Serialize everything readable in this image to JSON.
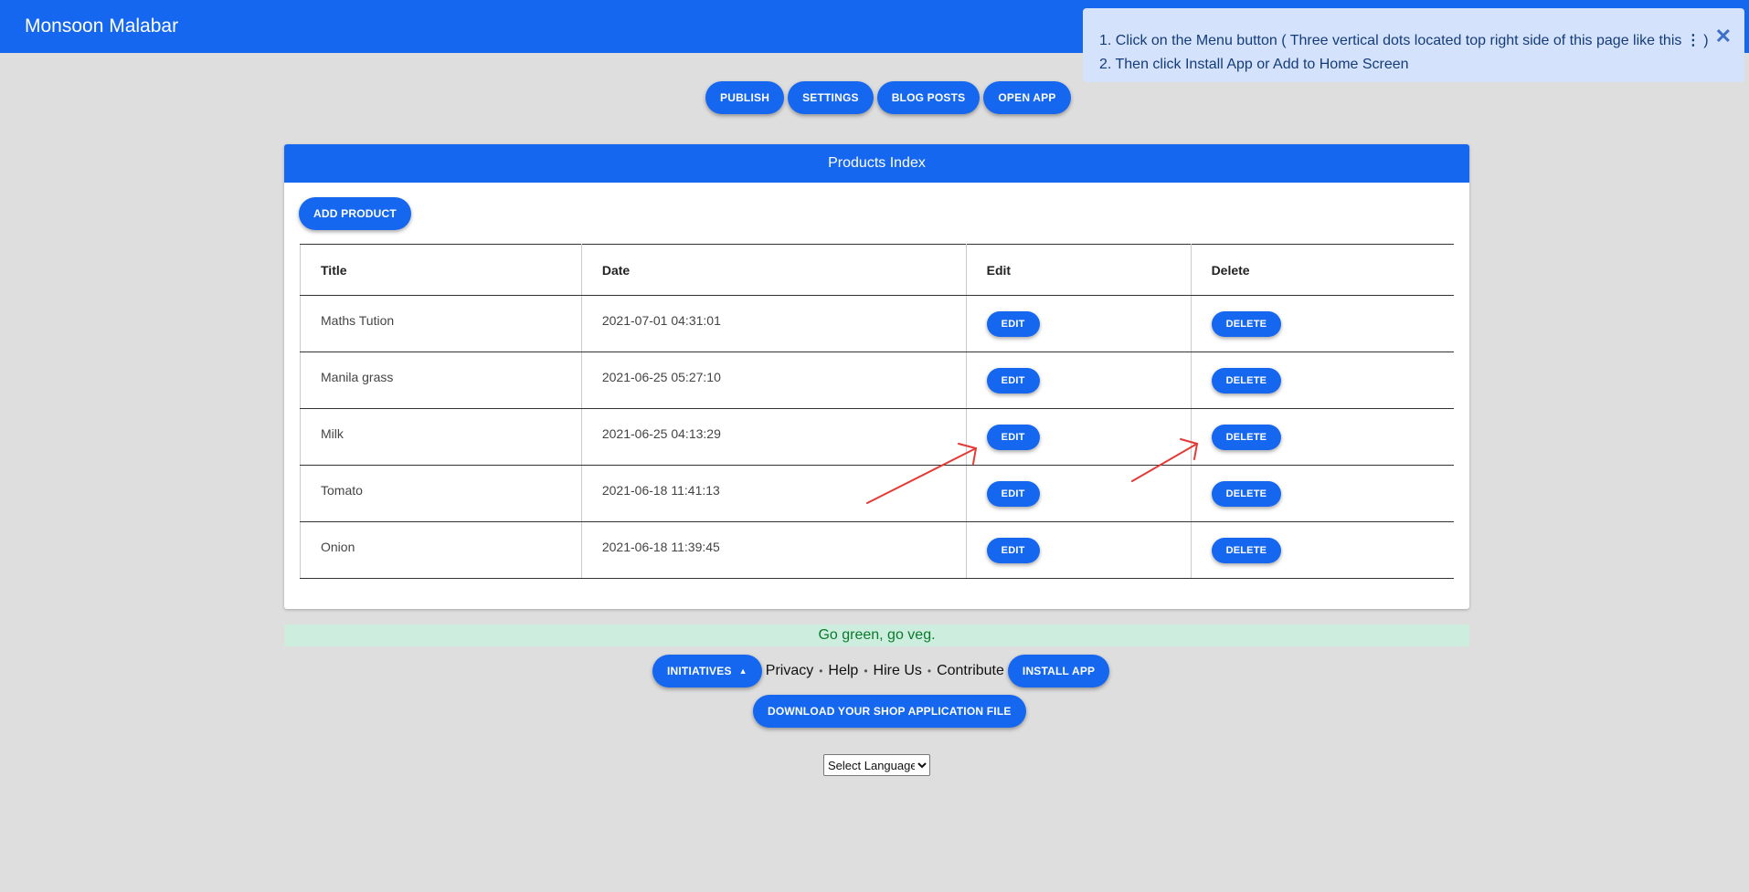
{
  "app": {
    "title": "Monsoon Malabar"
  },
  "nav": {
    "buttons": [
      "PUBLISH",
      "SETTINGS",
      "BLOG POSTS",
      "OPEN APP"
    ]
  },
  "toast": {
    "line1_prefix": "1. Click on the Menu button ( Three vertical dots located top right side of this page like this ",
    "line1_dots": "⋮",
    "line1_suffix": " )",
    "line2": "2. Then click Install App or Add to Home Screen",
    "close": "✕"
  },
  "products": {
    "header": "Products Index",
    "add_label": "ADD PRODUCT",
    "columns": [
      "Title",
      "Date",
      "Edit",
      "Delete"
    ],
    "rows": [
      {
        "title": "Maths Tution",
        "date": "2021-07-01 04:31:01",
        "edit": "EDIT",
        "delete": "DELETE"
      },
      {
        "title": "Manila grass",
        "date": "2021-06-25 05:27:10",
        "edit": "EDIT",
        "delete": "DELETE"
      },
      {
        "title": "Milk",
        "date": "2021-06-25 04:13:29",
        "edit": "EDIT",
        "delete": "DELETE"
      },
      {
        "title": "Tomato",
        "date": "2021-06-18 11:41:13",
        "edit": "EDIT",
        "delete": "DELETE"
      },
      {
        "title": "Onion",
        "date": "2021-06-18 11:39:45",
        "edit": "EDIT",
        "delete": "DELETE"
      }
    ]
  },
  "banner": {
    "text": "Go green, go veg."
  },
  "footer": {
    "initiatives": "INITIATIVES",
    "links": [
      "Privacy",
      "Help",
      "Hire Us",
      "Contribute"
    ],
    "install": "INSTALL APP",
    "download": "DOWNLOAD YOUR SHOP APPLICATION FILE",
    "language": "Select Language"
  },
  "colors": {
    "primary": "#1667ef",
    "annotation_arrow": "#e53935",
    "banner_bg": "#cdeedf"
  },
  "icons": {
    "close": "close-icon",
    "dropdown": "caret-up-icon"
  }
}
